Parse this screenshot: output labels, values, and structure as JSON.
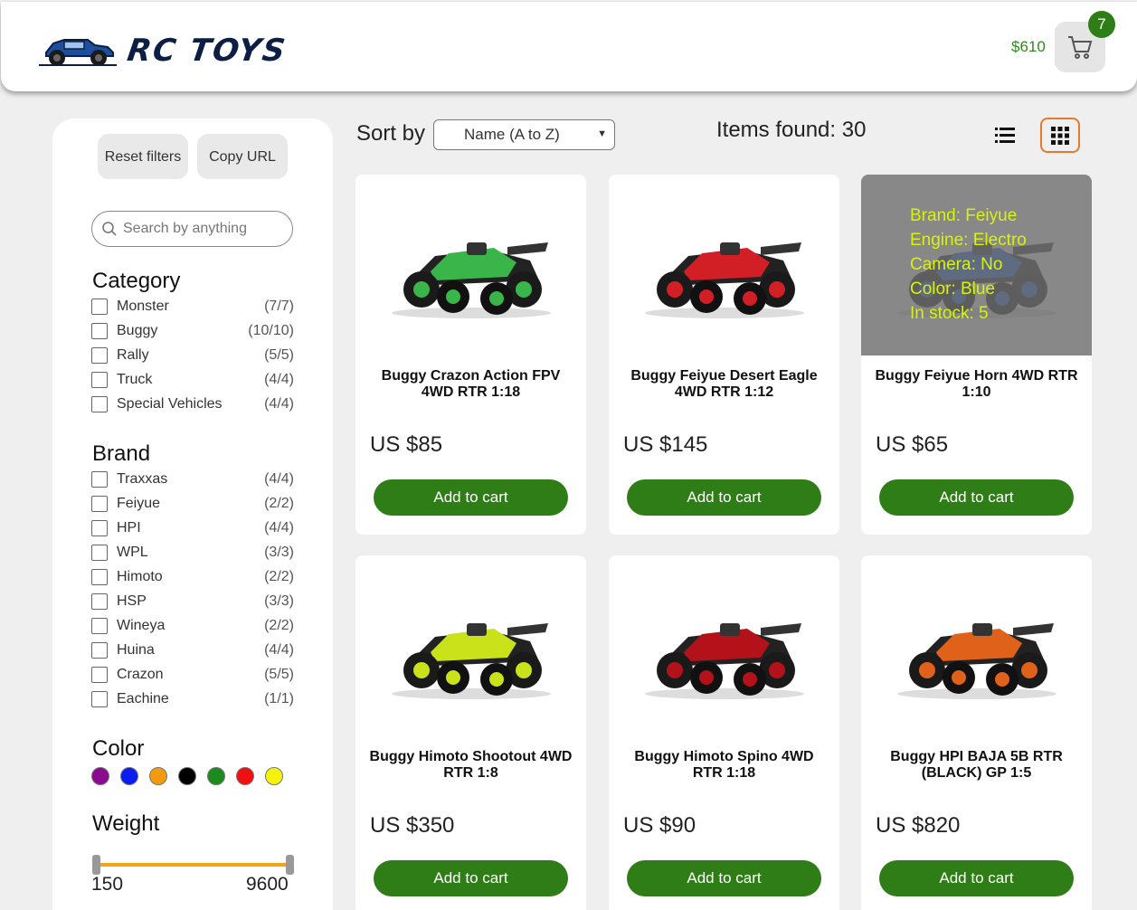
{
  "header": {
    "brand": "RC TOYS",
    "cart_total": "$610",
    "cart_count": "7"
  },
  "sidebar": {
    "reset_label": "Reset filters",
    "copy_label": "Copy URL",
    "search_placeholder": "Search by anything",
    "category_title": "Category",
    "categories": [
      {
        "name": "Monster",
        "count": "(7/7)"
      },
      {
        "name": "Buggy",
        "count": "(10/10)"
      },
      {
        "name": "Rally",
        "count": "(5/5)"
      },
      {
        "name": "Truck",
        "count": "(4/4)"
      },
      {
        "name": "Special Vehicles",
        "count": "(4/4)"
      }
    ],
    "brand_title": "Brand",
    "brands": [
      {
        "name": "Traxxas",
        "count": "(4/4)"
      },
      {
        "name": "Feiyue",
        "count": "(2/2)"
      },
      {
        "name": "HPI",
        "count": "(4/4)"
      },
      {
        "name": "WPL",
        "count": "(3/3)"
      },
      {
        "name": "Himoto",
        "count": "(2/2)"
      },
      {
        "name": "HSP",
        "count": "(3/3)"
      },
      {
        "name": "Wineya",
        "count": "(2/2)"
      },
      {
        "name": "Huina",
        "count": "(4/4)"
      },
      {
        "name": "Crazon",
        "count": "(5/5)"
      },
      {
        "name": "Eachine",
        "count": "(1/1)"
      }
    ],
    "color_title": "Color",
    "colors": [
      "#8b0a8f",
      "#0a1cf0",
      "#f29b10",
      "#000000",
      "#1e8a1e",
      "#f01010",
      "#f7f20a"
    ],
    "weight_title": "Weight",
    "weight_min": "150",
    "weight_max": "9600"
  },
  "toolbar": {
    "sort_label": "Sort by",
    "sort_value": "Name (A to Z)",
    "items_found": "Items found: 30"
  },
  "products": [
    {
      "title": "Buggy Crazon Action FPV 4WD RTR 1:18",
      "price": "US $85",
      "button": "Add to cart",
      "color": "#39b54a"
    },
    {
      "title": "Buggy Feiyue Desert Eagle 4WD RTR 1:12",
      "price": "US $145",
      "button": "Add to cart",
      "color": "#d21f26"
    },
    {
      "title": "Buggy Feiyue Horn 4WD RTR 1:10",
      "price": "US $65",
      "button": "Add to cart",
      "color": "#1b5fd1",
      "details": [
        "Brand: Feiyue",
        "Engine: Electro",
        "Camera: No",
        "Color: Blue",
        "In stock: 5"
      ]
    },
    {
      "title": "Buggy Himoto Shootout 4WD RTR 1:8",
      "price": "US $350",
      "button": "Add to cart",
      "color": "#c9e21a"
    },
    {
      "title": "Buggy Himoto Spino 4WD RTR 1:18",
      "price": "US $90",
      "button": "Add to cart",
      "color": "#b3121a"
    },
    {
      "title": "Buggy HPI BAJA 5B RTR (BLACK) GP 1:5",
      "price": "US $820",
      "button": "Add to cart",
      "color": "#e0621a"
    }
  ]
}
